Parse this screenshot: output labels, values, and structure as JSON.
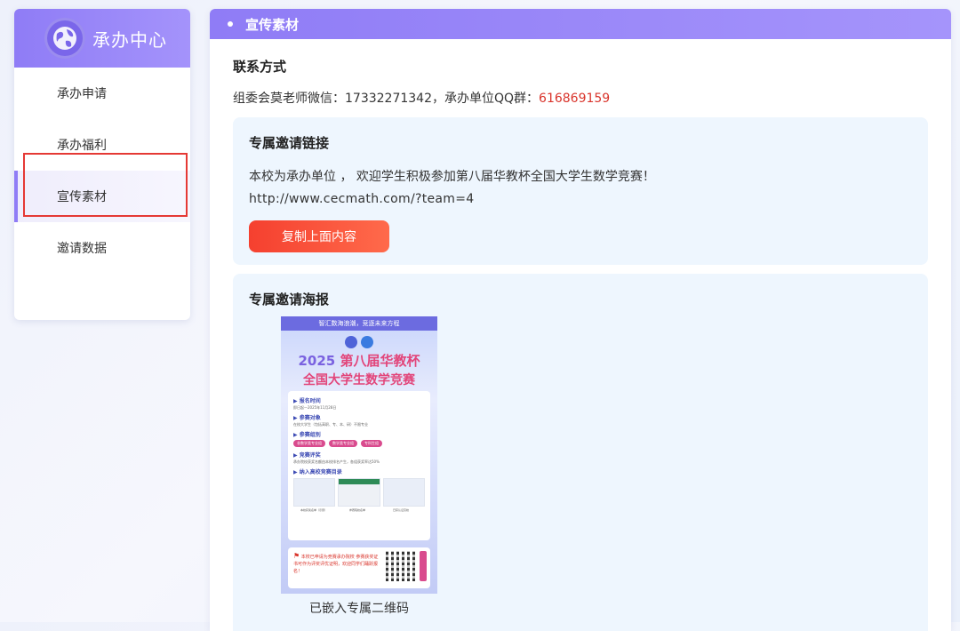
{
  "sidebar": {
    "title": "承办中心",
    "items": [
      {
        "label": "承办申请"
      },
      {
        "label": "承办福利"
      },
      {
        "label": "宣传素材"
      },
      {
        "label": "邀请数据"
      }
    ]
  },
  "main": {
    "header": "宣传素材",
    "contact": {
      "title": "联系方式",
      "text": "组委会莫老师微信：17332271342，承办单位QQ群：",
      "qq": "616869159"
    },
    "invite": {
      "title": "专属邀请链接",
      "text": "本校为承办单位 ， 欢迎学生积极参加第八届华教杯全国大学生数学竞赛！",
      "url": "http://www.cecmath.com/?team=4",
      "button": "复制上面内容"
    },
    "poster": {
      "title": "专属邀请海报",
      "caption": "已嵌入专属二维码",
      "top_banner": "智汇数海浪潮，竞逐未来方程",
      "headline_year": "2025",
      "headline_main": "第八届华教杯",
      "headline_sub": "全国大学生数学竞赛",
      "sections": [
        {
          "title": "▶ 报名时间",
          "text": "即日起—2025年11月28日"
        },
        {
          "title": "▶ 参赛对象",
          "text": "在校大学生（包括高职、专、本、研）不限专业"
        },
        {
          "title": "▶ 参赛组别",
          "tags": [
            "非数学类专业组",
            "数学类专业组",
            "专科生组"
          ]
        },
        {
          "title": "▶ 竞赛评奖",
          "text": "承办院校获奖名额由本校排名产生，各组获奖率达50%"
        },
        {
          "title": "▶ 纳入高校竞赛目录"
        }
      ],
      "thumb_captions": [
        "本校获奖名单（示意）",
        "参赛院校名单",
        "已获认证高校"
      ],
      "footer_text": "本校已申请为竞赛承办院校 参赛获奖证书可作为评奖评优证明，欢迎同学们踊跃报名！",
      "footer_side": "立即报名"
    }
  }
}
